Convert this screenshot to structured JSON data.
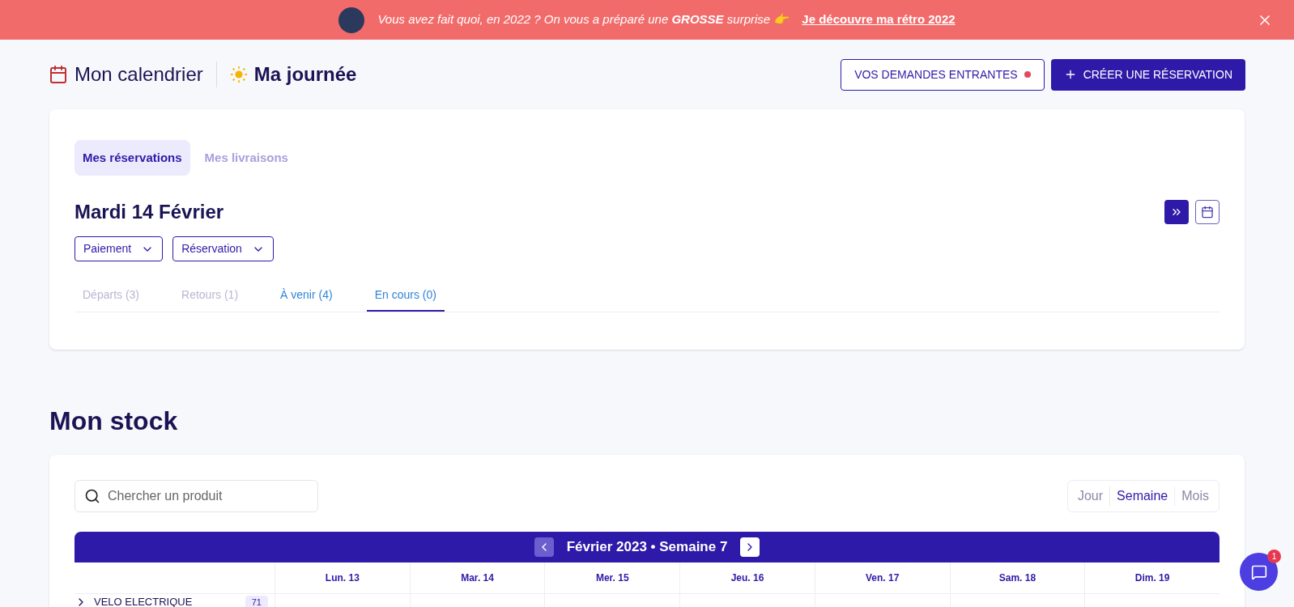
{
  "banner": {
    "text": "Vous avez fait quoi, en 2022 ? On vous a préparé une **GROSSE** surprise 👉",
    "link": "Je découvre ma rétro 2022"
  },
  "header": {
    "title": "Mon calendrier",
    "subtitle": "Ma journée",
    "buttons": [
      {
        "kind": "outline",
        "label": "VOS DEMANDES ENTRANTES",
        "dot": true
      },
      {
        "kind": "primary",
        "label": "CRÉER UNE RÉSERVATION"
      }
    ]
  },
  "tabs": [
    {
      "label": "Mes réservations",
      "selected": true
    },
    {
      "label": "Mes livraisons",
      "selected": false
    }
  ],
  "day": {
    "title": "Mardi 14 Février",
    "filters": [
      "Paiement",
      "Réservation"
    ],
    "subtabs": [
      {
        "label": "Départs (3)",
        "selected": false,
        "disabled": true
      },
      {
        "label": "Retours (1)",
        "selected": false,
        "disabled": true
      },
      {
        "label": "À venir (4)",
        "selected": false,
        "disabled": false
      },
      {
        "label": "En cours (0)",
        "selected": true,
        "disabled": false
      }
    ]
  },
  "stock": {
    "title": "Mon stock",
    "search": {
      "placeholder": "Chercher un produit"
    },
    "views": [
      {
        "label": "Jour",
        "selected": false
      },
      {
        "label": "Semaine",
        "selected": true
      },
      {
        "label": "Mois",
        "selected": false
      }
    ],
    "period": "Février 2023 • Semaine 7",
    "days": [
      "Lun. 13",
      "Mar. 14",
      "Mer. 15",
      "Jeu. 16",
      "Ven. 17",
      "Sam. 18",
      "Dim. 19"
    ],
    "rows": [
      {
        "name": "VELO ELECTRIQUE",
        "count": "71",
        "expanded": false
      }
    ]
  },
  "chat": {
    "badge": "1"
  }
}
